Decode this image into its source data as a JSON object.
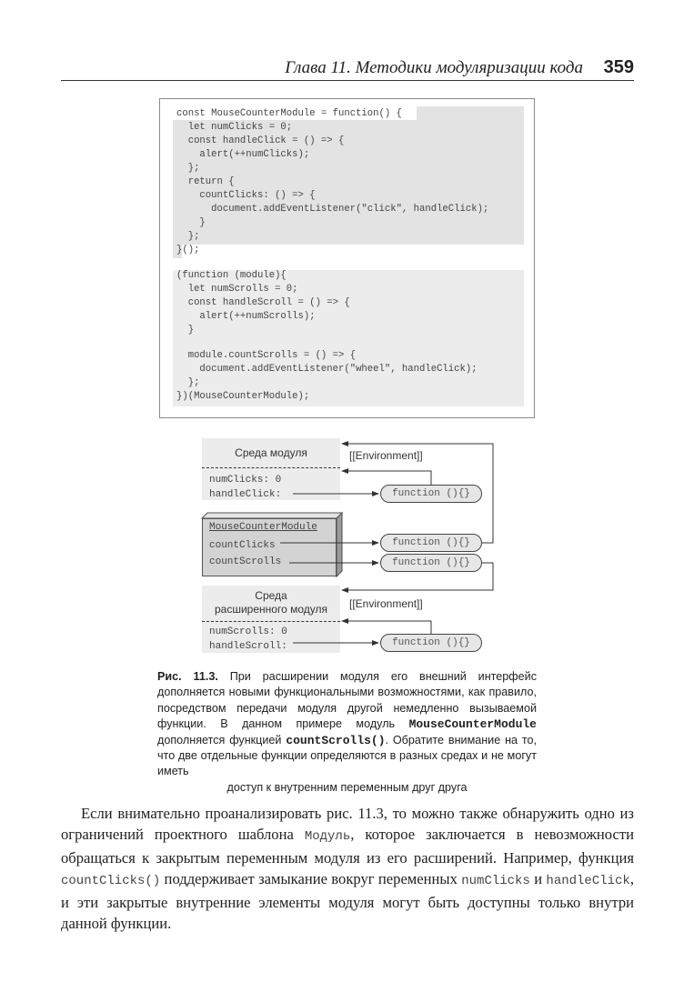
{
  "header": {
    "chapter_title": "Глава 11. Методики модуляризации кода",
    "page_number": "359"
  },
  "code_listing": {
    "lines": [
      "const MouseCounterModule = function() {",
      "  let numClicks = 0;",
      "  const handleClick = () => {",
      "    alert(++numClicks);",
      "  };",
      "  return {",
      "    countClicks: () => {",
      "      document.addEventListener(\"click\", handleClick);",
      "    }",
      "  };",
      "}();",
      "",
      "(function (module){",
      "  let numScrolls = 0;",
      "  const handleScroll = () => {",
      "    alert(++numScrolls);",
      "  }",
      "",
      "  module.countScrolls = () => {",
      "    document.addEventListener(\"wheel\", handleClick);",
      "  };",
      "})(MouseCounterModule);"
    ]
  },
  "diagram": {
    "module_env": {
      "title": "Среда модуля",
      "vars": [
        "numClicks: 0",
        "handleClick:"
      ]
    },
    "module_object": {
      "name": "MouseCounterModule",
      "props": [
        "countClicks",
        "countScrolls"
      ]
    },
    "extended_env": {
      "title_line1": "Среда",
      "title_line2": "расширенного модуля",
      "vars": [
        "numScrolls: 0",
        "handleScroll:"
      ]
    },
    "environment_label": "[[Environment]]",
    "function_label": "function (){}"
  },
  "caption": {
    "label": "Рис. 11.3.",
    "text_1": " При расширении модуля его внешний интерфейс дополняется новыми функциональными возможностями, как правило, посредством передачи модуля другой немедленно вызываемой функции. В данном примере модуль ",
    "code_1": "MouseCounterModule",
    "text_2": " дополняется функцией ",
    "code_2": "countScrolls()",
    "text_3": ". Обратите внимание на то, что две отдельные функции определяются в разных средах и не могут иметь",
    "text_last": "доступ к внутренним переменным друг друга"
  },
  "body": {
    "t1": "Если внимательно проанализировать рис. 11.3, то можно также обнаружить одно из ограничений проектного шаблона ",
    "c1": "Модуль",
    "t2": ", которое заключается в невозможности обращаться к закрытым переменным модуля из его расширений. Например, функция ",
    "c2": "countClicks()",
    "t3": " поддерживает замыкание вокруг переменных ",
    "c3": "numClicks",
    "t4": " и ",
    "c4": "handleClick",
    "t5": ", и эти закрытые внутренние элементы модуля могут быть доступны только внутри данной функции."
  }
}
